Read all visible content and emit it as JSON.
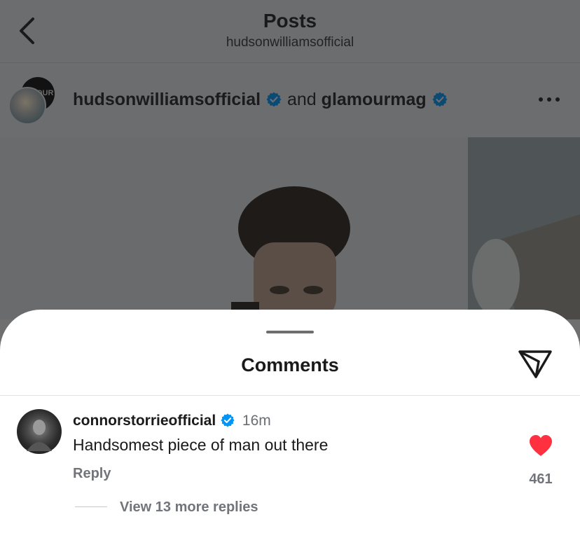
{
  "header": {
    "title": "Posts",
    "subtitle": "hudsonwilliamsofficial"
  },
  "post": {
    "author_primary": "hudsonwilliamsofficial",
    "connector": "and",
    "author_secondary": "glamourmag",
    "collab_avatar_text": "OUR"
  },
  "comments_sheet": {
    "title": "Comments",
    "comment": {
      "username": "connorstorrieofficial",
      "time": "16m",
      "text": "Handsomest piece of man out there",
      "reply_label": "Reply",
      "like_count": "461",
      "view_replies": "View 13 more replies"
    }
  },
  "icons": {
    "back": "chevron-left-icon",
    "verified": "verified-badge-icon",
    "more": "more-horizontal-icon",
    "share": "paper-plane-icon",
    "like": "heart-filled-icon"
  },
  "colors": {
    "verified": "#0095f6",
    "like": "#ff3040",
    "overlay": "#6c6d6f"
  }
}
